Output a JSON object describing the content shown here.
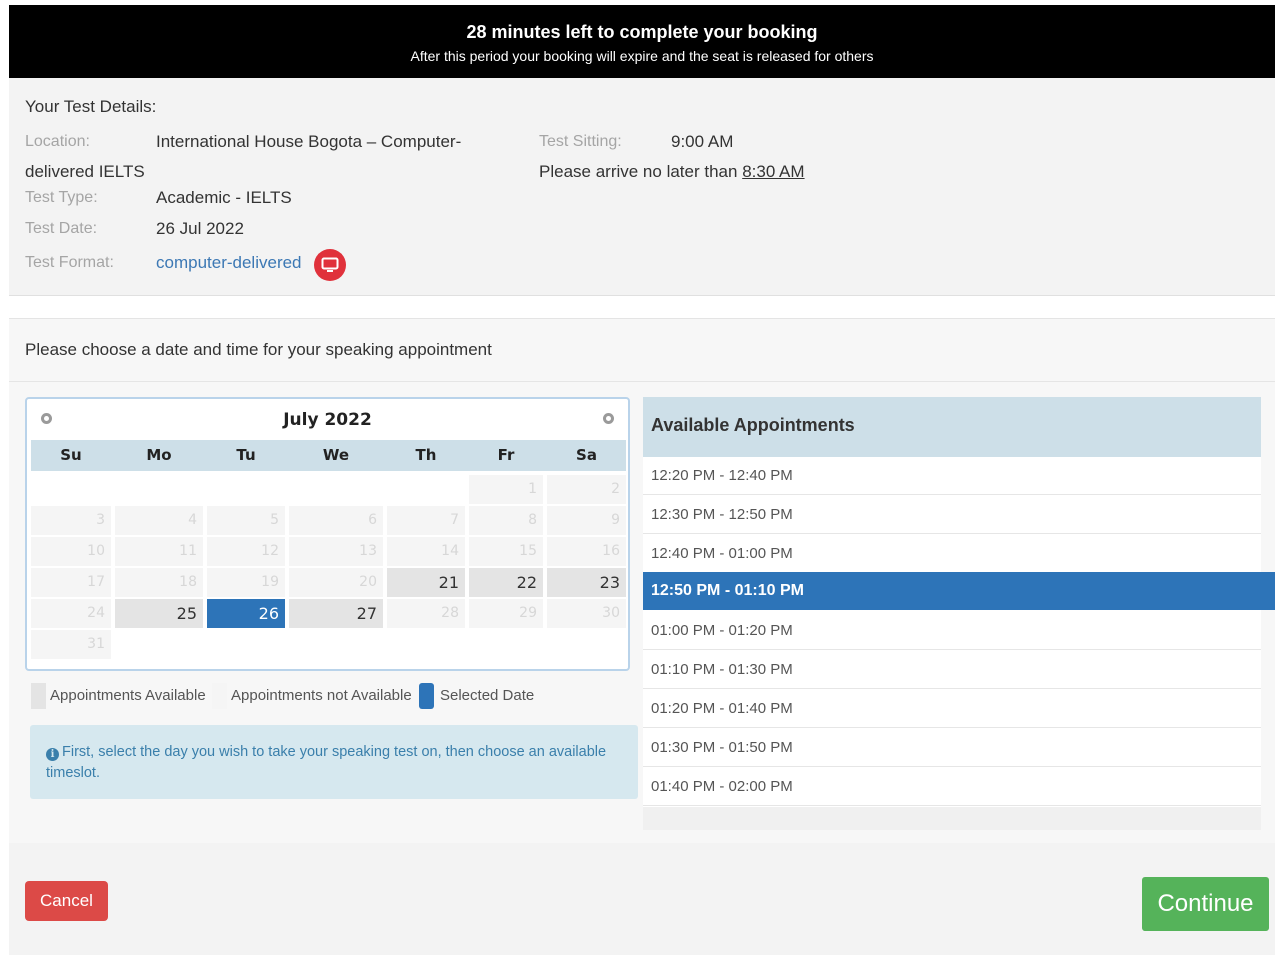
{
  "banner": {
    "title": "28 minutes left to complete your booking",
    "subtitle": "After this period your booking will expire and the seat is released for others"
  },
  "test_details": {
    "heading": "Your Test Details:",
    "location_label": "Location:",
    "location_value_line1": "International House Bogota – Computer-",
    "location_value_line2": "delivered IELTS",
    "type_label": "Test Type:",
    "type_value": "Academic - IELTS",
    "date_label": "Test Date:",
    "date_value": "26 Jul 2022",
    "format_label": "Test Format:",
    "format_value": "computer-delivered",
    "sitting_label": "Test Sitting:",
    "sitting_value": "9:00 AM",
    "arrive_text": "Please arrive no later than",
    "arrive_time": "8:30 AM"
  },
  "speaking": {
    "heading": "Please choose a date and time for your speaking appointment"
  },
  "calendar": {
    "month_title": "July 2022",
    "weekdays": [
      "Su",
      "Mo",
      "Tu",
      "We",
      "Th",
      "Fr",
      "Sa"
    ],
    "weeks": [
      [
        null,
        null,
        null,
        null,
        null,
        {
          "d": "1",
          "s": "na"
        },
        {
          "d": "2",
          "s": "na"
        }
      ],
      [
        {
          "d": "3",
          "s": "na"
        },
        {
          "d": "4",
          "s": "na"
        },
        {
          "d": "5",
          "s": "na"
        },
        {
          "d": "6",
          "s": "na"
        },
        {
          "d": "7",
          "s": "na"
        },
        {
          "d": "8",
          "s": "na"
        },
        {
          "d": "9",
          "s": "na"
        }
      ],
      [
        {
          "d": "10",
          "s": "na"
        },
        {
          "d": "11",
          "s": "na"
        },
        {
          "d": "12",
          "s": "na"
        },
        {
          "d": "13",
          "s": "na"
        },
        {
          "d": "14",
          "s": "na"
        },
        {
          "d": "15",
          "s": "na"
        },
        {
          "d": "16",
          "s": "na"
        }
      ],
      [
        {
          "d": "17",
          "s": "na"
        },
        {
          "d": "18",
          "s": "na"
        },
        {
          "d": "19",
          "s": "na"
        },
        {
          "d": "20",
          "s": "na"
        },
        {
          "d": "21",
          "s": "av"
        },
        {
          "d": "22",
          "s": "av"
        },
        {
          "d": "23",
          "s": "av"
        }
      ],
      [
        {
          "d": "24",
          "s": "na"
        },
        {
          "d": "25",
          "s": "av"
        },
        {
          "d": "26",
          "s": "sel"
        },
        {
          "d": "27",
          "s": "av"
        },
        {
          "d": "28",
          "s": "na"
        },
        {
          "d": "29",
          "s": "na"
        },
        {
          "d": "30",
          "s": "na"
        }
      ],
      [
        {
          "d": "31",
          "s": "na"
        },
        null,
        null,
        null,
        null,
        null,
        null
      ]
    ]
  },
  "legend": {
    "available": "Appointments Available",
    "not_available": "Appointments not Available",
    "selected": "Selected Date"
  },
  "info": {
    "icon": "info-icon",
    "text": "First, select the day you wish to take your speaking test on, then choose an available timeslot."
  },
  "appointments": {
    "heading": "Available Appointments",
    "slots": [
      "12:20 PM - 12:40 PM",
      "12:30 PM - 12:50 PM",
      "12:40 PM - 01:00 PM",
      "12:50 PM - 01:10 PM",
      "01:00 PM - 01:20 PM",
      "01:10 PM - 01:30 PM",
      "01:20 PM - 01:40 PM",
      "01:30 PM - 01:50 PM",
      "01:40 PM - 02:00 PM"
    ],
    "selected_index": 3
  },
  "buttons": {
    "cancel": "Cancel",
    "continue": "Continue"
  },
  "colors": {
    "selected": "#2d74b8",
    "cancel": "#dc4a47",
    "continue": "#55b35a",
    "format_icon": "#e0313b"
  }
}
